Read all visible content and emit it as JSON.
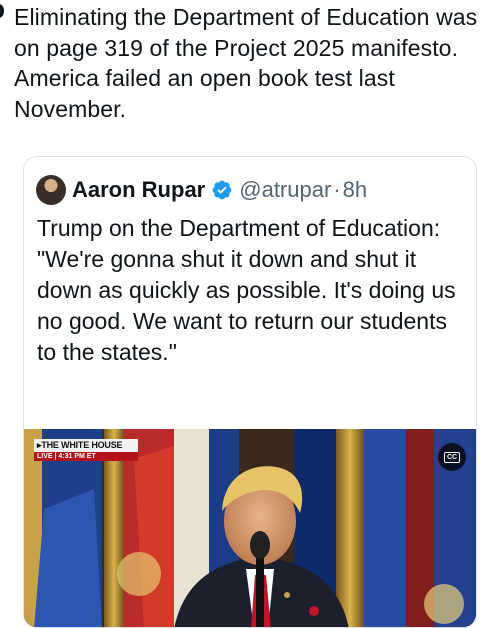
{
  "post": {
    "text": "Eliminating the Department of Education was on page 319 of the Project 2025 manifesto. America failed an open book test last November."
  },
  "quote": {
    "author_name": "Aaron Rupar",
    "verified_icon": "verified-badge-icon",
    "handle": "@atrupar",
    "separator": "·",
    "time": "8h",
    "text": "Trump on the Department of Education: \"We're gonna shut it down and shut it down as quickly as possible. It's doing us no good. We want to return our students to the states.\"",
    "media": {
      "live_top": "▸THE WHITE HOUSE",
      "live_bottom": "LIVE  |  4:31 PM ET",
      "cc_label": "CC"
    }
  },
  "colors": {
    "text": "#0f1419",
    "secondary": "#536471",
    "verified": "#1d9bf0",
    "live_red": "#b3121b"
  }
}
